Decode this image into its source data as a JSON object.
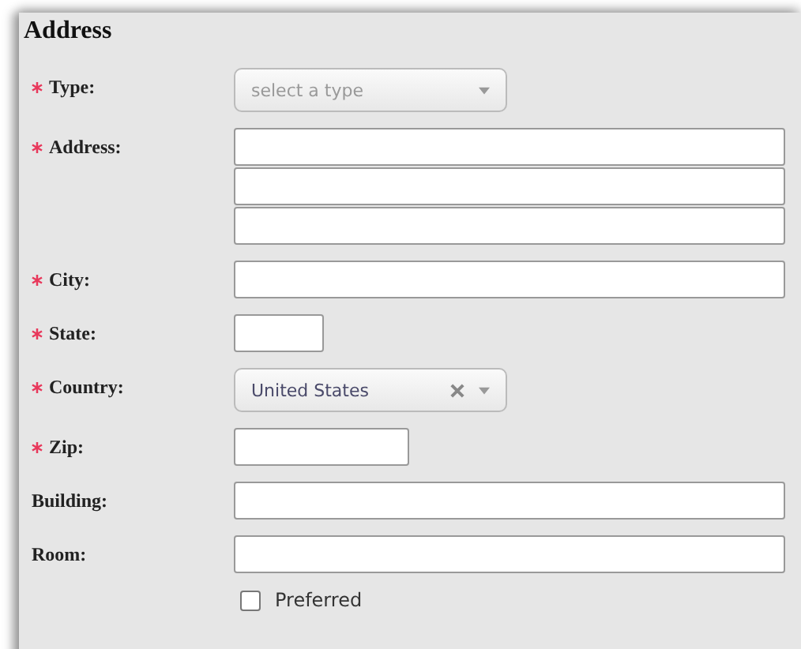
{
  "section": {
    "title": "Address"
  },
  "rows": [
    {
      "label": "Type:",
      "required": true,
      "fields": [
        {
          "kind": "select",
          "placeholder": "select a type",
          "clearable": false
        }
      ]
    },
    {
      "label": "Address:",
      "required": true,
      "fields": [
        {
          "kind": "text"
        },
        {
          "kind": "text"
        },
        {
          "kind": "text"
        }
      ]
    },
    {
      "label": "City:",
      "required": true,
      "fields": [
        {
          "kind": "text"
        }
      ]
    },
    {
      "label": "State:",
      "required": true,
      "fields": [
        {
          "kind": "short"
        }
      ]
    },
    {
      "label": "Country:",
      "required": true,
      "fields": [
        {
          "kind": "select",
          "value": "United States",
          "clearable": true
        }
      ]
    },
    {
      "label": "Zip:",
      "required": true,
      "fields": [
        {
          "kind": "medium"
        }
      ]
    },
    {
      "label": "Building:",
      "required": false,
      "fields": [
        {
          "kind": "text"
        }
      ]
    },
    {
      "label": "Room:",
      "required": false,
      "fields": [
        {
          "kind": "text"
        }
      ]
    }
  ],
  "preferred": {
    "label": "Preferred",
    "checked": false
  }
}
